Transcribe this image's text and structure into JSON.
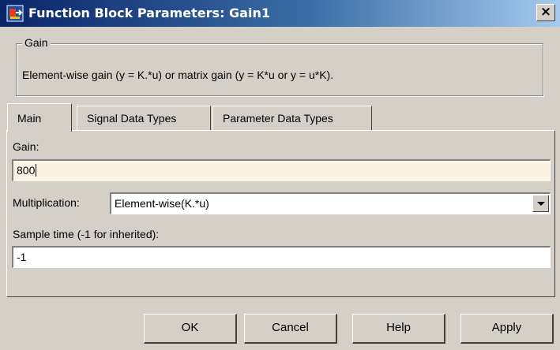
{
  "window": {
    "title": "Function Block Parameters: Gain1",
    "close_glyph": "×",
    "icon": "simulink-block-icon"
  },
  "group": {
    "legend": "Gain",
    "description": "Element-wise gain (y = K.*u) or matrix gain (y = K*u or y = u*K)."
  },
  "tabs": [
    {
      "label": "Main",
      "active": true
    },
    {
      "label": "Signal Data Types",
      "active": false
    },
    {
      "label": "Parameter Data Types",
      "active": false
    }
  ],
  "main": {
    "gain_label": "Gain:",
    "gain_value": "800",
    "multiplication_label": "Multiplication:",
    "multiplication_value": "Element-wise(K.*u)",
    "sample_time_label": "Sample time (-1 for inherited):",
    "sample_time_value": "-1"
  },
  "buttons": {
    "ok": "OK",
    "cancel": "Cancel",
    "help": "Help",
    "apply": "Apply"
  },
  "colors": {
    "titlebar_start": "#0a246a",
    "titlebar_end": "#a6caf0",
    "dialog_face": "#d4d0c8",
    "active_field_bg": "#fdf3e3"
  }
}
